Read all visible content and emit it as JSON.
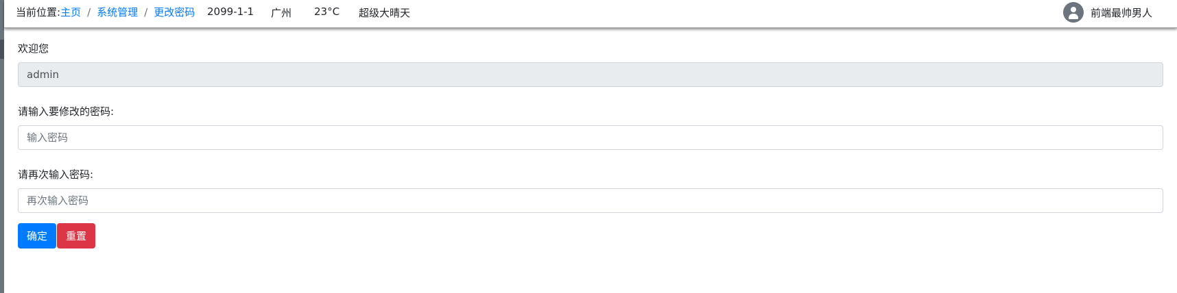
{
  "header": {
    "breadcrumb_lead": "当前位置:",
    "breadcrumb": [
      "主页",
      "系统管理",
      "更改密码"
    ],
    "breadcrumb_separator": "/",
    "date": "2099-1-1",
    "city": "广州",
    "temperature": "23°C",
    "weather": "超级大晴天",
    "username": "前端最帅男人",
    "avatar_icon": "user-avatar-icon"
  },
  "form": {
    "welcome_label": "欢迎您",
    "account_value": "admin",
    "new_password_label": "请输入要修改的密码:",
    "new_password_placeholder": "输入密码",
    "confirm_password_label": "请再次输入密码:",
    "confirm_password_placeholder": "再次输入密码",
    "submit_label": "确定",
    "reset_label": "重置"
  },
  "colors": {
    "link": "#007bff",
    "primary": "#007bff",
    "danger": "#dc3545",
    "readonly_bg": "#e9ecef",
    "side_bar": "#6c757d"
  }
}
